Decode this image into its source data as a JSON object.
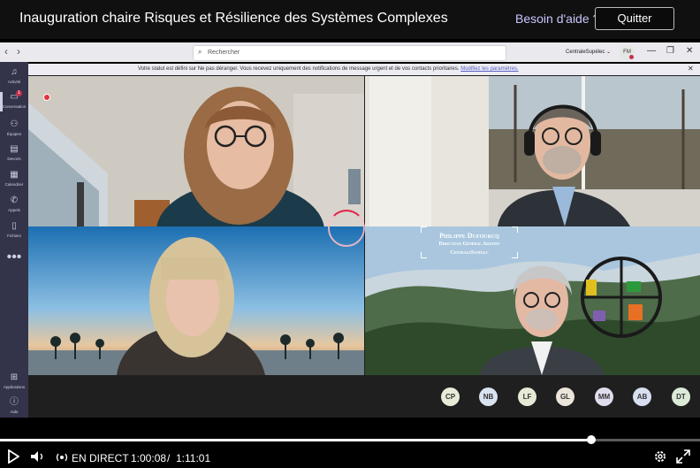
{
  "event": {
    "title": "Inauguration chaire Risques et Résilience des Systèmes Complexes",
    "help_label": "Besoin d'aide ?",
    "quit_label": "Quitter"
  },
  "teams": {
    "search_placeholder": "Rechercher",
    "tenant": "CentraleSupélec",
    "user_initials": "FM",
    "nav_back": "‹",
    "nav_forward": "›",
    "window_min": "—",
    "window_restore": "❐",
    "window_close": "✕"
  },
  "rail": {
    "items": [
      {
        "label": "Activité",
        "icon": "bell-icon",
        "glyph": "🔔"
      },
      {
        "label": "Conversation",
        "icon": "chat-icon",
        "glyph": "💬",
        "badge": "1"
      },
      {
        "label": "Équipes",
        "icon": "teams-icon",
        "glyph": "👥"
      },
      {
        "label": "Devoirs",
        "icon": "assignments-icon",
        "glyph": "📋"
      },
      {
        "label": "Calendrier",
        "icon": "calendar-icon",
        "glyph": "📅"
      },
      {
        "label": "Appels",
        "icon": "phone-icon",
        "glyph": "📞"
      },
      {
        "label": "Fichiers",
        "icon": "files-icon",
        "glyph": "📄"
      }
    ],
    "more": "•••",
    "bottom": [
      {
        "label": "Applications",
        "icon": "apps-icon",
        "glyph": "⊞"
      },
      {
        "label": "Aide",
        "icon": "help-icon",
        "glyph": "?"
      }
    ]
  },
  "notification": {
    "text": "Votre statut est défini sur Ne pas déranger. Vous recevez uniquement des notifications de message urgent et de vos contacts prioritaires.",
    "link": "Modifiez les paramètres."
  },
  "namecard": {
    "name": "Philippe Dufourcq",
    "role": "Directeur Général Adjoint",
    "org": "CentraleSupélec"
  },
  "participants": [
    {
      "initials": "CP",
      "color": "#e7ecd8"
    },
    {
      "initials": "NB",
      "color": "#d9e3f0"
    },
    {
      "initials": "LF",
      "color": "#e4ead5"
    },
    {
      "initials": "GL",
      "color": "#ece3d9"
    },
    {
      "initials": "MM",
      "color": "#e1dcec"
    },
    {
      "initials": "AB",
      "color": "#d7dff0"
    },
    {
      "initials": "DT",
      "color": "#dcebd8"
    }
  ],
  "player": {
    "live_label": "EN DIRECT",
    "current_time": "1:00:08",
    "separator": "/",
    "duration": "1:11:01",
    "progress": 0.845
  },
  "colors": {
    "accent": "#5b5fc7",
    "rail": "#33344a",
    "dnd": "#c4314b"
  }
}
